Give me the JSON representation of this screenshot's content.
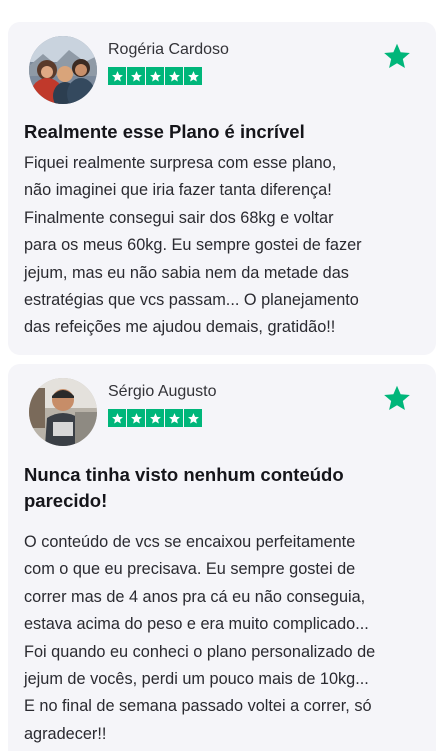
{
  "colors": {
    "card_background": "#f5f5f9",
    "rating_green": "#00b67a",
    "text": "#2a2a30"
  },
  "icons": {
    "rating_star": "star-icon",
    "trust_badge": "trustpilot-star-icon"
  },
  "reviews": [
    {
      "name": "Rogéria Cardoso",
      "rating": 5,
      "title": "Realmente esse Plano é incrível",
      "body_lines": [
        "Fiquei realmente surpresa com esse plano,",
        "não imaginei que iria fazer tanta diferença!",
        "Finalmente consegui sair dos 68kg e voltar",
        "para os meus 60kg. Eu sempre gostei de fazer",
        "jejum, mas eu não sabia nem da metade das",
        "estratégias que vcs passam... O planejamento",
        "das refeições me ajudou demais, gratidão!!"
      ]
    },
    {
      "name": "Sérgio Augusto",
      "rating": 5,
      "title_lines": [
        "Nunca tinha visto nenhum conteúdo",
        "parecido!"
      ],
      "body_lines": [
        "O conteúdo de vcs se encaixou perfeitamente",
        "com o que eu precisava. Eu sempre gostei de",
        "correr mas de 4 anos pra cá eu não conseguia,",
        "estava acima do peso e era muito complicado...",
        "Foi quando eu conheci o plano personalizado de",
        "jejum de vocês, perdi um pouco mais de 10kg...",
        "E no final de semana passado voltei a correr, só",
        "agradecer!!"
      ]
    }
  ]
}
